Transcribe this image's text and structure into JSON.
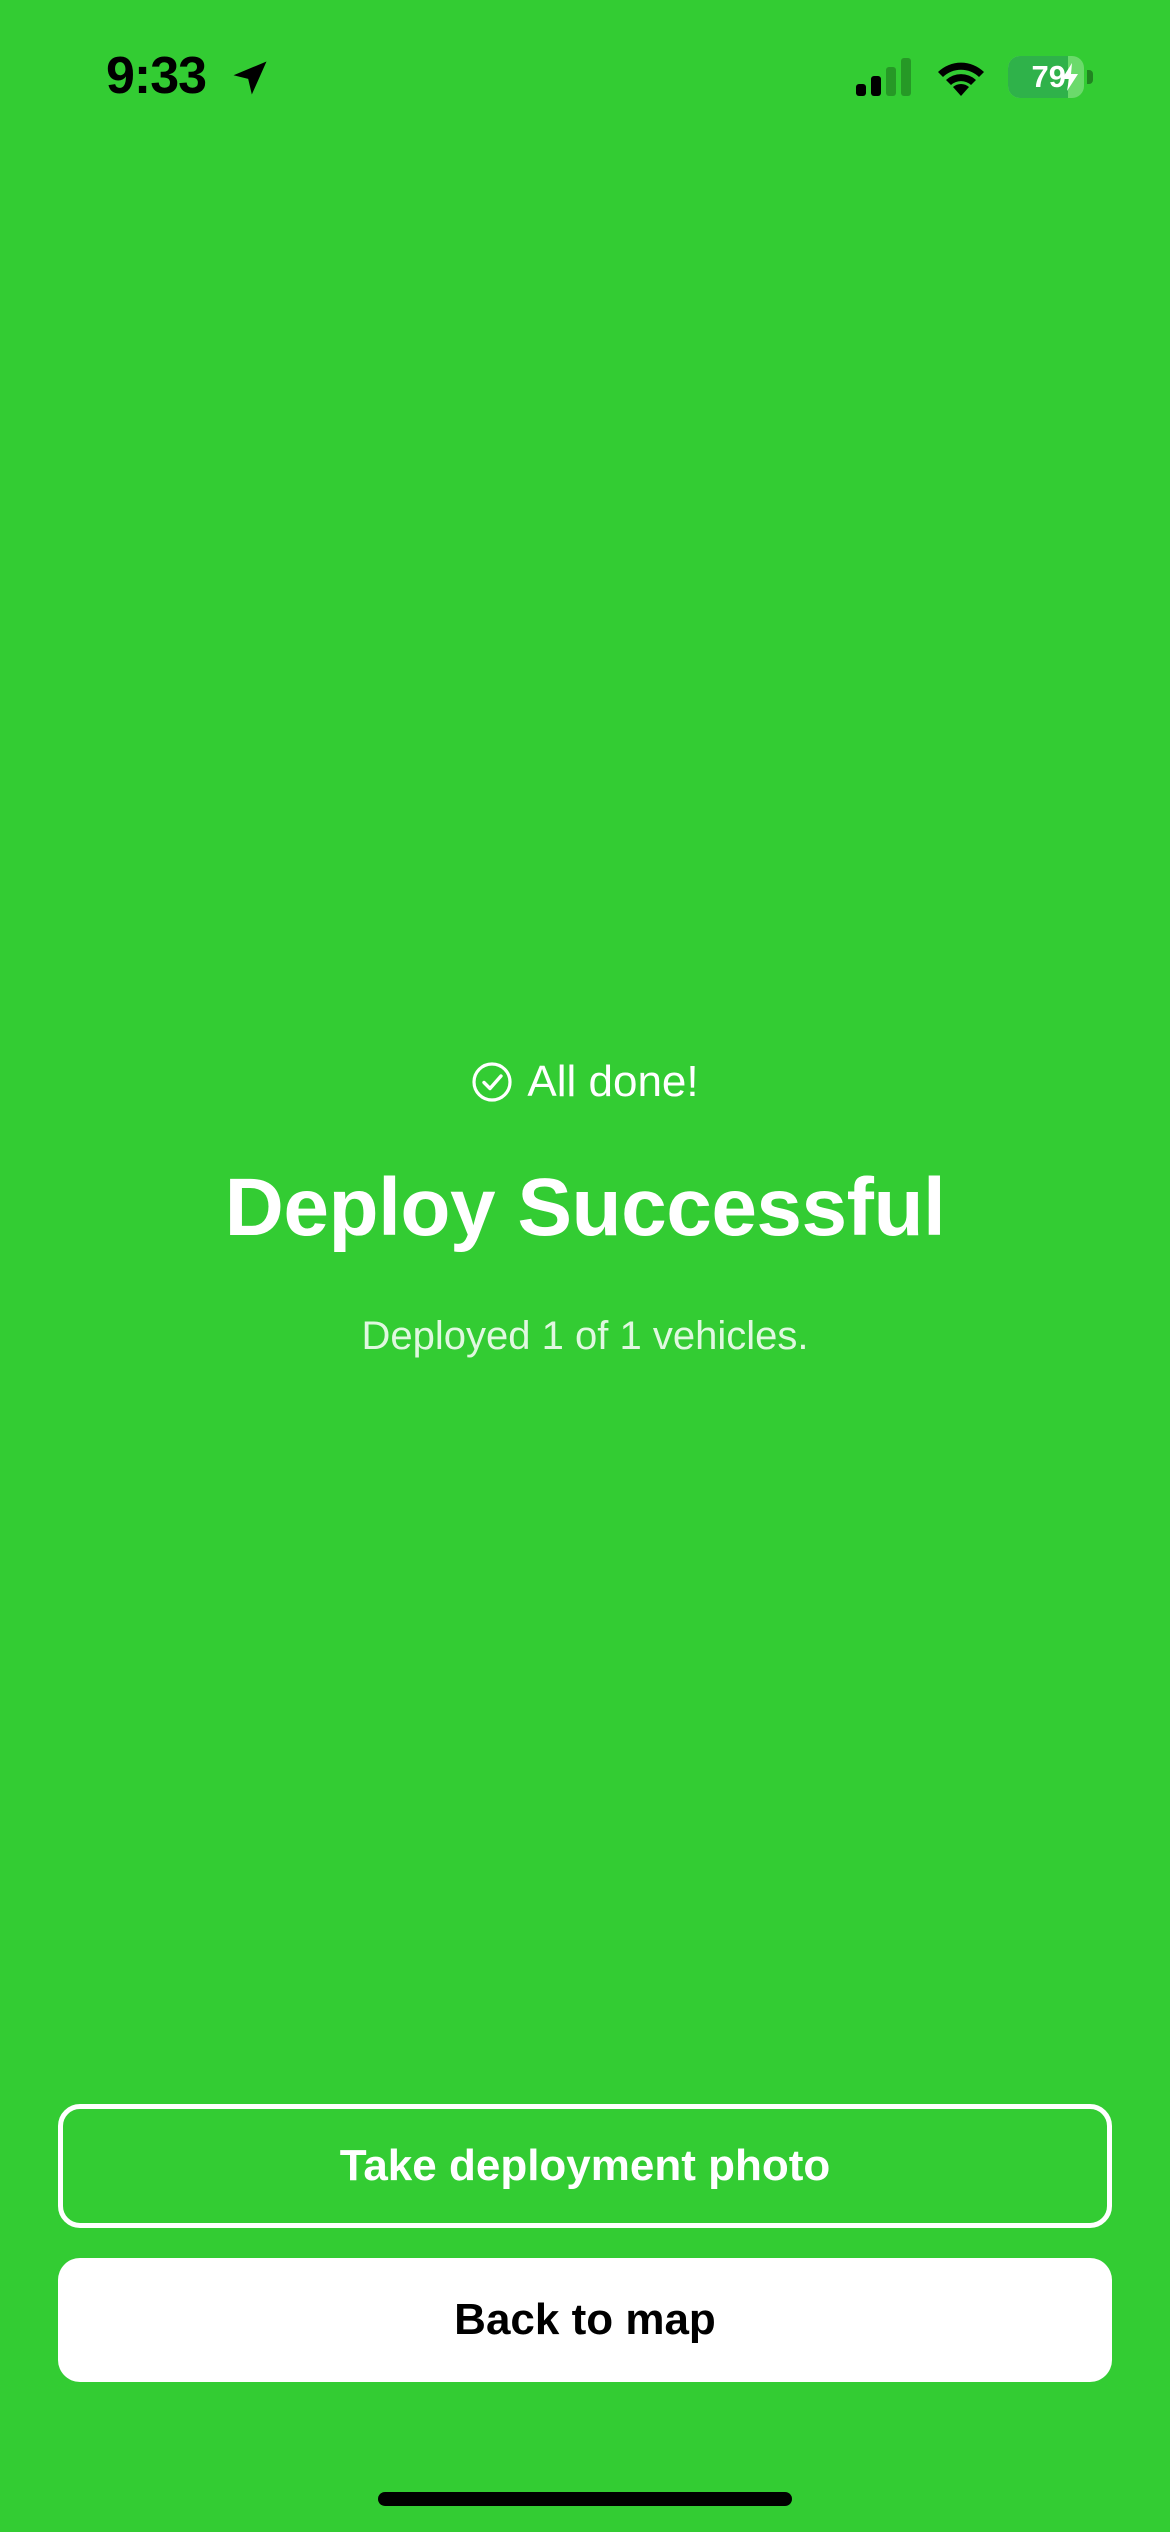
{
  "status_bar": {
    "time": "9:33",
    "battery_level": "79",
    "battery_fraction": 0.79,
    "charging": true,
    "icons": [
      "location-arrow-icon",
      "cellular-signal-icon",
      "wifi-icon",
      "battery-icon",
      "charging-bolt-icon"
    ]
  },
  "result": {
    "status_icon": "check-circle-icon",
    "status_text": "All done!",
    "title": "Deploy Successful",
    "summary": "Deployed 1 of 1 vehicles."
  },
  "actions": {
    "take_photo_label": "Take deployment photo",
    "back_to_map_label": "Back to map"
  },
  "colors": {
    "background": "#33CC33",
    "text": "#FFFFFF",
    "primary_button_bg": "#FFFFFF",
    "primary_button_text": "#000000"
  }
}
